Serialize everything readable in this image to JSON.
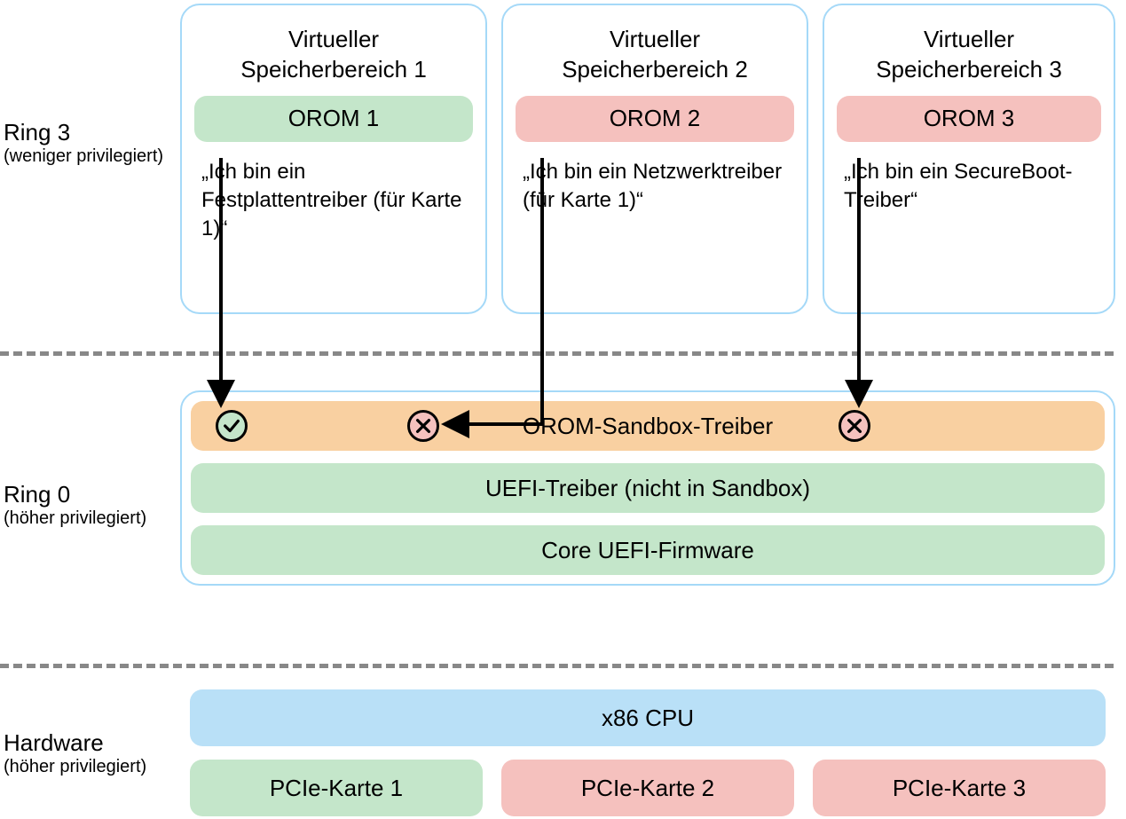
{
  "labels": {
    "ring3": {
      "title": "Ring 3",
      "sub": "(weniger privilegiert)"
    },
    "ring0": {
      "title": "Ring 0",
      "sub": "(höher privilegiert)"
    },
    "hw": {
      "title": "Hardware",
      "sub": "(höher privilegiert)"
    }
  },
  "vmem": [
    {
      "title_l1": "Virtueller",
      "title_l2": "Speicherbereich 1",
      "orom": "OROM 1",
      "color": "green",
      "desc": "„Ich bin ein Festplattentreiber (für Karte 1)“"
    },
    {
      "title_l1": "Virtueller",
      "title_l2": "Speicherbereich 2",
      "orom": "OROM 2",
      "color": "red",
      "desc": "„Ich bin ein Netzwerktreiber (für Karte 1)“"
    },
    {
      "title_l1": "Virtueller",
      "title_l2": "Speicherbereich 3",
      "orom": "OROM 3",
      "color": "red",
      "desc": "„Ich bin ein SecureBoot-Treiber“"
    }
  ],
  "ring0": {
    "sandbox": "OROM-Sandbox-Treiber",
    "uefi_drivers": "UEFI-Treiber (nicht in Sandbox)",
    "uefi_core": "Core UEFI-Firmware"
  },
  "hardware": {
    "cpu": "x86 CPU",
    "cards": [
      "PCIe-Karte 1",
      "PCIe-Karte 2",
      "PCIe-Karte 3"
    ]
  },
  "status": {
    "ok": "ok",
    "blocked1": "blocked",
    "blocked2": "blocked"
  }
}
